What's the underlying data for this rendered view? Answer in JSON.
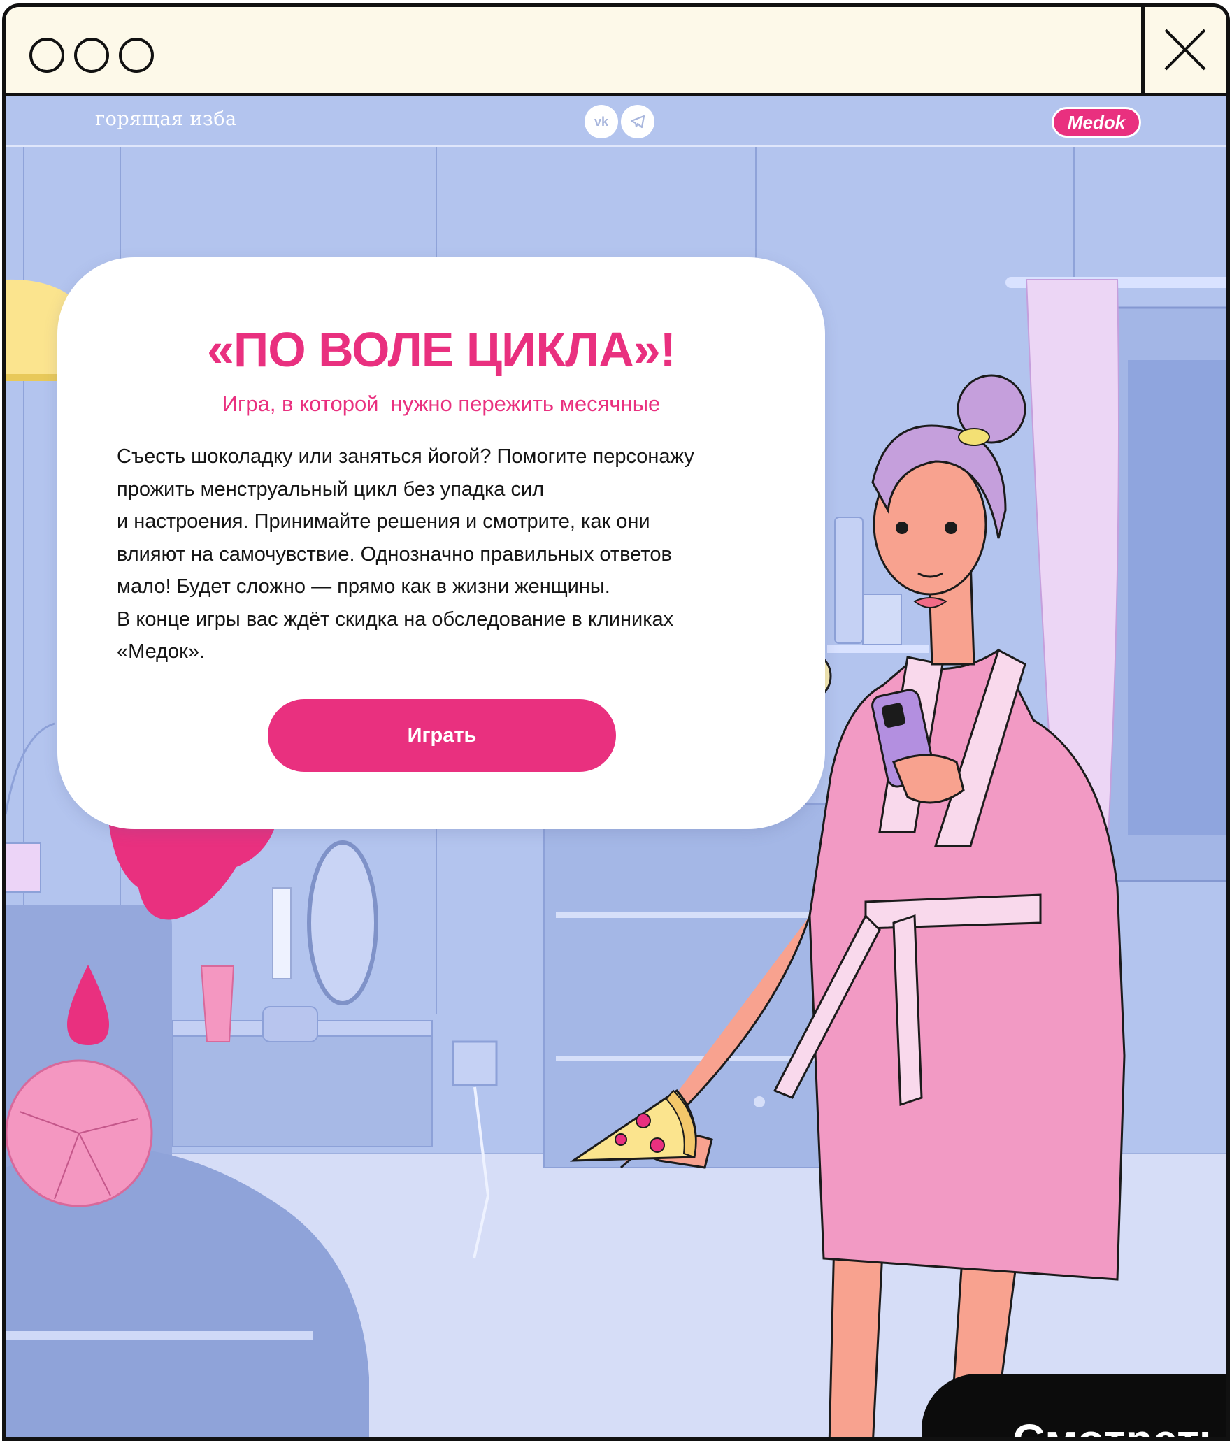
{
  "window": {
    "traffic_lights": [
      "window-dot-1",
      "window-dot-2",
      "window-dot-3"
    ],
    "close_icon": "close-icon"
  },
  "header": {
    "brand": "горящая изба",
    "social": [
      {
        "icon": "vk-icon",
        "label": "vk"
      },
      {
        "icon": "telegram-icon",
        "label": ""
      }
    ],
    "partner_logo": "Medok"
  },
  "card": {
    "title": "«ПО ВОЛЕ ЦИКЛА»!",
    "subtitle": "Игра, в которой  нужно пережить месячные",
    "body_lines": [
      "Съесть шоколадку или заняться йогой? Помогите персонажу",
      "прожить менструальный цикл без упадка сил",
      "и настроения. Принимайте решения и смотрите, как они",
      "влияют на самочувствие. Однозначно правильных ответов",
      "мало! Будет сложно — прямо как в жизни женщины.",
      "В конце игры вас ждёт скидка на обследование в клиниках",
      "«Медок»."
    ],
    "play_button": "Играть"
  },
  "watch_button": "Смотреть",
  "colors": {
    "accent": "#e9307f",
    "background": "#b3c4ee",
    "titlebar": "#fdf9e9"
  },
  "icons": [
    "neutral-face-icon",
    "pizza-icon",
    "phone-icon",
    "drop-icon"
  ]
}
